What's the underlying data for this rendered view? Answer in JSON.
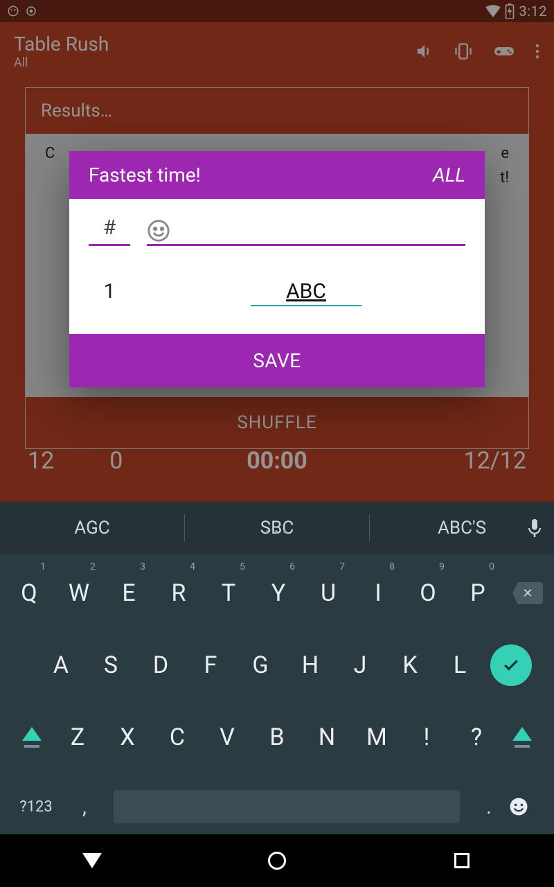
{
  "status": {
    "time": "3:12"
  },
  "appbar": {
    "title": "Table Rush",
    "subtitle": "All"
  },
  "card": {
    "header": "Results…",
    "body_line1": "C",
    "body_line2": "e",
    "body_line3": "t!"
  },
  "shuffle": {
    "label": "SHUFFLE"
  },
  "stats": {
    "left1": "12",
    "left2": "0",
    "center": "00:00",
    "right": "12/12"
  },
  "dialog": {
    "title": "Fastest time!",
    "tag": "ALL",
    "hash": "#",
    "rank": "1",
    "name": "ABC",
    "save": "SAVE"
  },
  "keyboard": {
    "suggestions": [
      "AGC",
      "SBC",
      "ABC'S"
    ],
    "row1": [
      {
        "k": "Q",
        "n": "1"
      },
      {
        "k": "W",
        "n": "2"
      },
      {
        "k": "E",
        "n": "3"
      },
      {
        "k": "R",
        "n": "4"
      },
      {
        "k": "T",
        "n": "5"
      },
      {
        "k": "Y",
        "n": "6"
      },
      {
        "k": "U",
        "n": "7"
      },
      {
        "k": "I",
        "n": "8"
      },
      {
        "k": "O",
        "n": "9"
      },
      {
        "k": "P",
        "n": "0"
      }
    ],
    "row2": [
      "A",
      "S",
      "D",
      "F",
      "G",
      "H",
      "J",
      "K",
      "L"
    ],
    "row3": [
      "Z",
      "X",
      "C",
      "V",
      "B",
      "N",
      "M",
      "!",
      "?"
    ],
    "sym": "?123",
    "comma": ",",
    "period": "."
  }
}
